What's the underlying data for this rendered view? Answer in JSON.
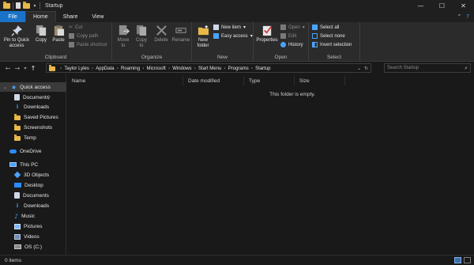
{
  "window": {
    "title": "Startup"
  },
  "tabs": {
    "file": "File",
    "home": "Home",
    "share": "Share",
    "view": "View"
  },
  "ribbon": {
    "clipboard": {
      "label": "Clipboard",
      "pin": "Pin to Quick\naccess",
      "copy": "Copy",
      "paste": "Paste",
      "cut": "Cut",
      "copy_path": "Copy path",
      "paste_shortcut": "Paste shortcut"
    },
    "organize": {
      "label": "Organize",
      "move_to": "Move\nto",
      "copy_to": "Copy\nto",
      "delete": "Delete",
      "rename": "Rename"
    },
    "new": {
      "label": "New",
      "new_folder": "New\nfolder",
      "new_item": "New item",
      "easy_access": "Easy access"
    },
    "open": {
      "label": "Open",
      "properties": "Properties",
      "open": "Open",
      "edit": "Edit",
      "history": "History"
    },
    "select": {
      "label": "Select",
      "select_all": "Select all",
      "select_none": "Select none",
      "invert": "Invert selection"
    }
  },
  "address": {
    "crumbs": [
      "Taylor Lyles",
      "AppData",
      "Roaming",
      "Microsoft",
      "Windows",
      "Start Menu",
      "Programs",
      "Startup"
    ],
    "search_placeholder": "Search Startup"
  },
  "nav": {
    "quick_access": "Quick access",
    "pinned": [
      "Documents",
      "Downloads",
      "Saved Pictures",
      "Screenshots",
      "Temp"
    ],
    "onedrive": "OneDrive",
    "this_pc": "This PC",
    "pc_items": [
      "3D Objects",
      "Desktop",
      "Documents",
      "Downloads",
      "Music",
      "Pictures",
      "Videos",
      "OS (C:)"
    ]
  },
  "columns": {
    "name": "Name",
    "date": "Date modified",
    "type": "Type",
    "size": "Size"
  },
  "content": {
    "empty_message": "This folder is empty."
  },
  "status": {
    "count": "0 items"
  },
  "colors": {
    "accent": "#1a73c9",
    "background": "#191919",
    "ribbon": "#2b2b2b",
    "folder": "#e8b84a"
  }
}
